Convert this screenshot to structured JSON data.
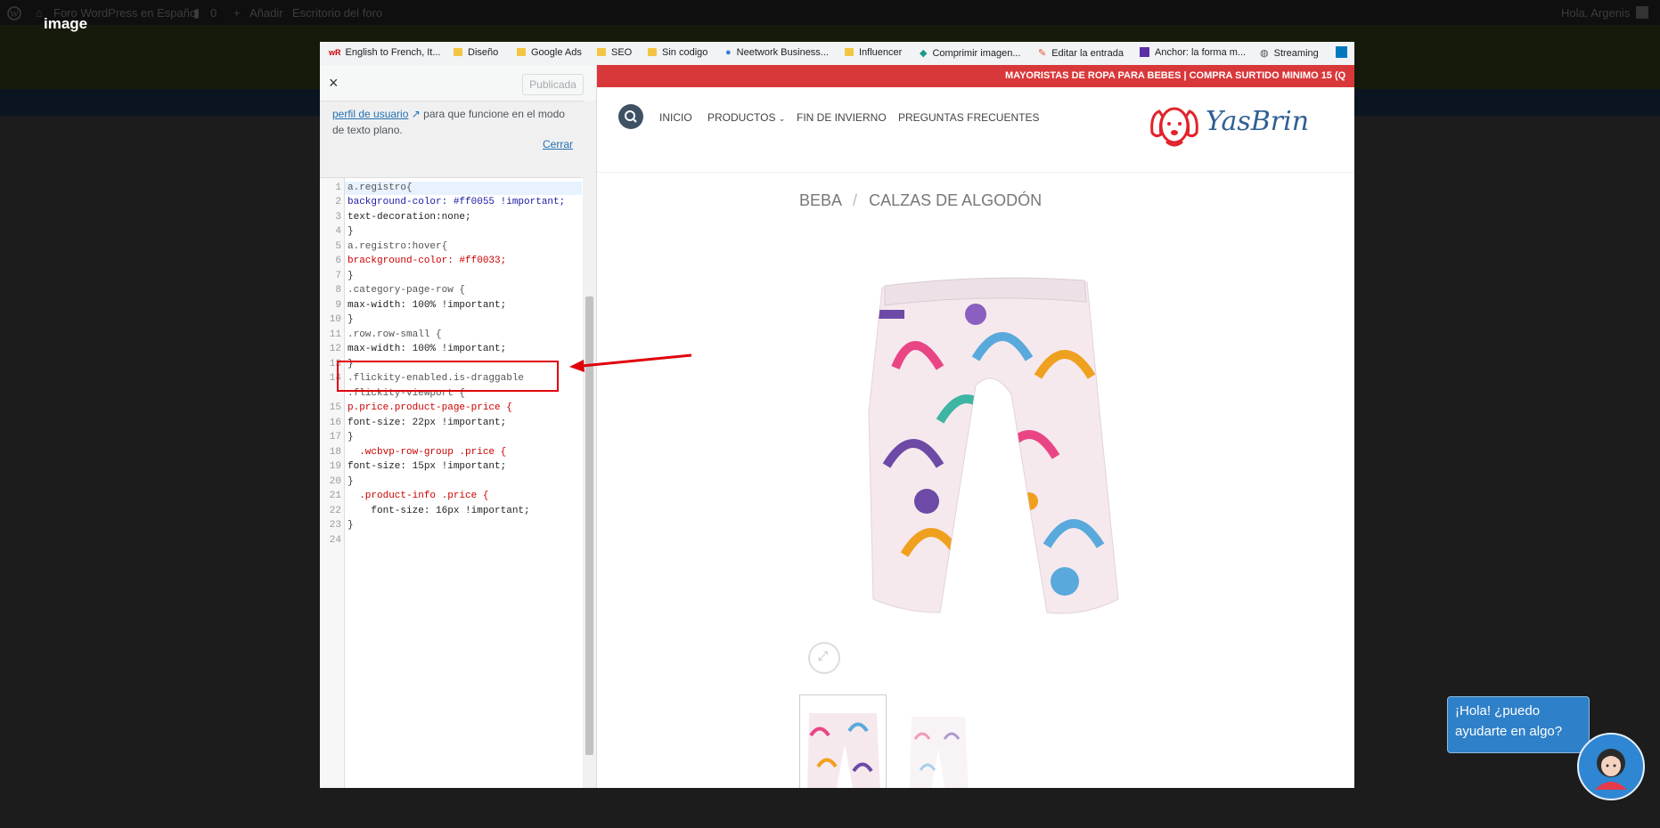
{
  "lightbox": {
    "title": "image"
  },
  "wp_admin_bar": {
    "site_name": "Foro WordPress en Español",
    "comments_count": "0",
    "add_label": "Añadir",
    "forum_desk": "Escritorio del foro",
    "greeting": "Hola, Argenis"
  },
  "bookmarks": [
    "English to French, It...",
    "Diseño",
    "Google Ads",
    "SEO",
    "Sin codigo",
    "Neetwork Business...",
    "Influencer",
    "Comprimir imagen...",
    "Editar la entrada",
    "Anchor: la forma m...",
    "Streaming"
  ],
  "customizer": {
    "close_label": "×",
    "publish_label": "Publicada",
    "note_link": "perfil de usuario",
    "note_text": "para que funcione en el modo de texto plano.",
    "cerrar_label": "Cerrar"
  },
  "code_lines": [
    "a.registro{",
    "background-color: #ff0055 !important;",
    "text-decoration:none;",
    "}",
    "a.registro:hover{",
    "brackground-color: #ff0033;",
    "}",
    ".category-page-row {",
    "max-width: 100% !important;",
    "}",
    ".row.row-small {",
    "max-width: 100% !important;",
    "}",
    ".flickity-enabled.is-draggable",
    ".flickity-viewport {",
    "p.price.product-page-price {",
    "font-size: 22px !important;",
    "}",
    "  .wcbvp-row-group .price {",
    "font-size: 15px !important;",
    "}",
    "  .product-info .price {",
    "    font-size: 16px !important;",
    "}",
    ""
  ],
  "line_numbers": [
    "1",
    "2",
    "3",
    "4",
    "5",
    "6",
    "7",
    "8",
    "9",
    "10",
    "11",
    "12",
    "13",
    "14",
    "",
    "15",
    "16",
    "17",
    "18",
    "19",
    "20",
    "21",
    "22",
    "23",
    "24"
  ],
  "store": {
    "promo": "MAYORISTAS DE ROPA PARA BEBES | COMPRA SURTIDO MINIMO 15 (Q",
    "nav_inicio": "INICIO",
    "nav_productos": "PRODUCTOS",
    "nav_fin": "FIN DE INVIERNO",
    "nav_preguntas": "PREGUNTAS FRECUENTES",
    "logo_text": "YasBrin",
    "crumb_1": "BEBA",
    "crumb_sep": "/",
    "crumb_2": "CALZAS DE ALGODÓN"
  },
  "chat": {
    "line1": "¡Hola! ¿puedo",
    "line2": "ayudarte en algo?"
  },
  "colors": {
    "promo_bg": "#d9383a",
    "chat_bg": "#2e80c8",
    "annotation_red": "#e0000a"
  }
}
